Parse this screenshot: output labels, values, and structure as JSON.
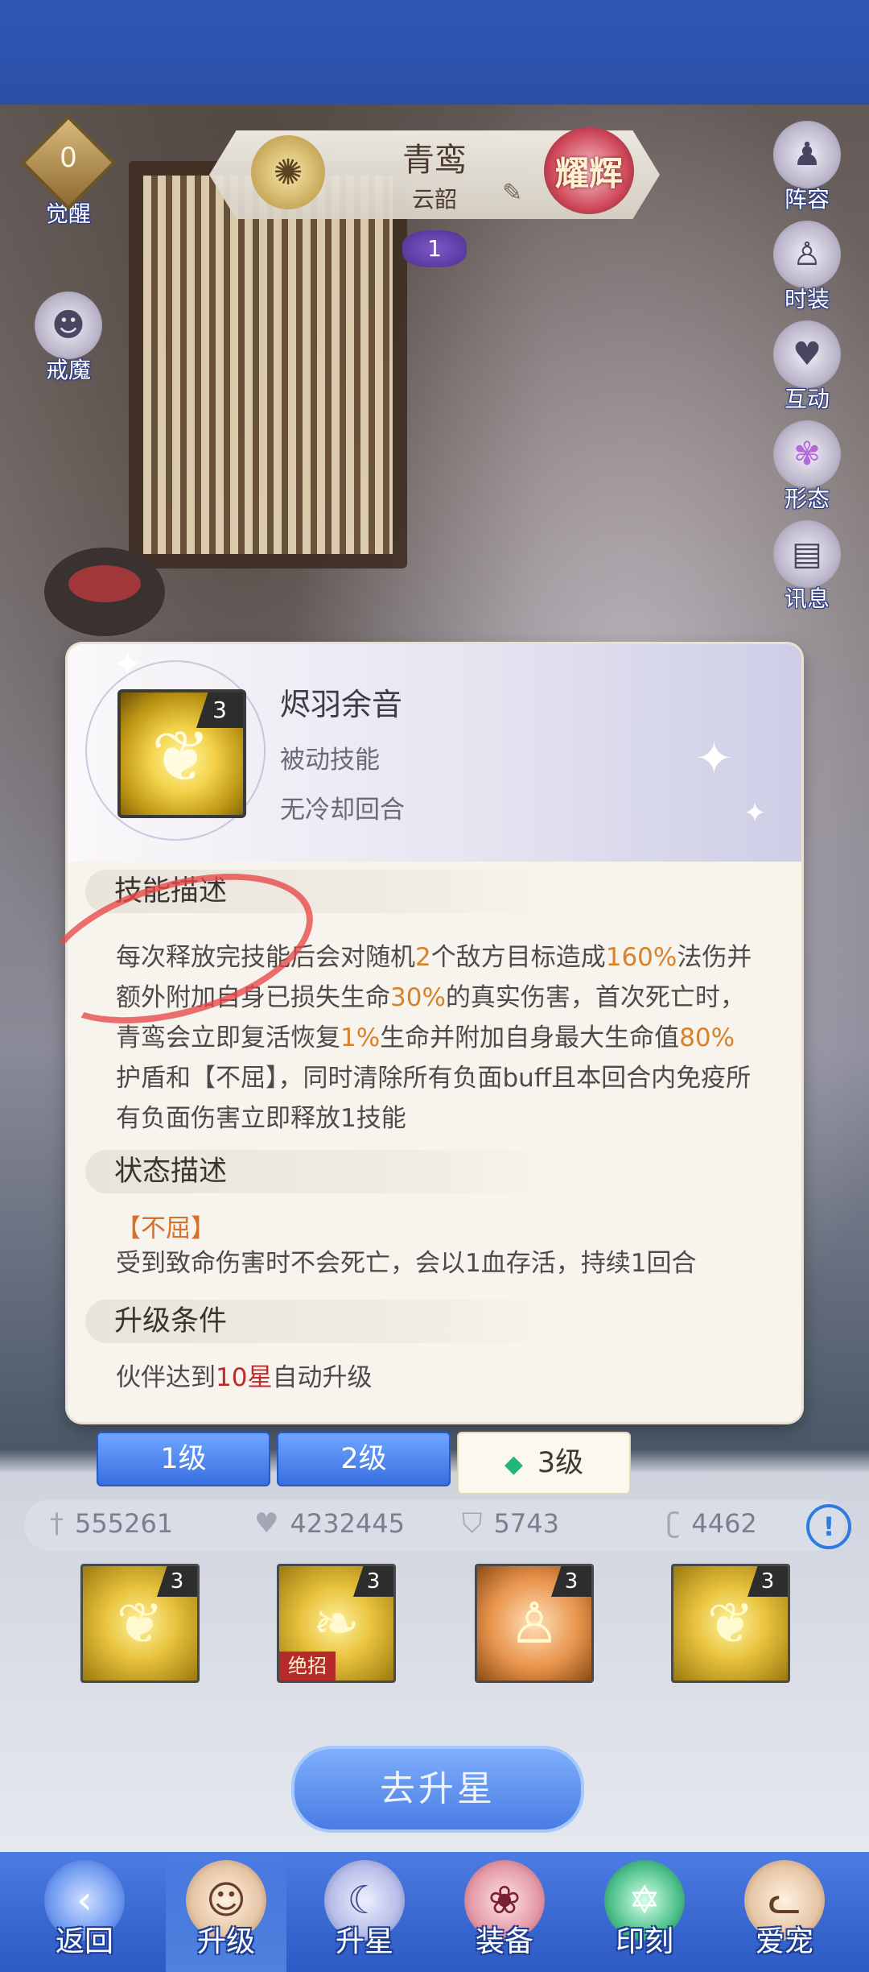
{
  "header": {
    "hero_name": "青鸾",
    "hero_subtitle": "云韶",
    "rank_label": "耀辉",
    "star_level": "1",
    "element_icon": "gear-sun-icon"
  },
  "left_buttons": {
    "awaken_count": "0",
    "awaken_label": "觉醒",
    "exorcise_label": "戒魔"
  },
  "right_buttons": [
    "阵容",
    "时装",
    "互动",
    "形态",
    "讯息"
  ],
  "popup": {
    "skill_name": "烬羽余音",
    "skill_level": "3",
    "skill_type": "被动技能",
    "cooldown": "无冷却回合",
    "desc_title": "技能描述",
    "desc_segments": [
      {
        "text": "每次释放完技能后会对随机",
        "hl": false
      },
      {
        "text": "2",
        "hl": true
      },
      {
        "text": "个敌方目标造成",
        "hl": false
      },
      {
        "text": "160%",
        "hl": true
      },
      {
        "text": "法伤并额外附加自身已损失生命",
        "hl": false
      },
      {
        "text": "30%",
        "hl": true
      },
      {
        "text": "的真实伤害，首次死亡时，青鸾会立即复活恢复",
        "hl": false
      },
      {
        "text": "1%",
        "hl": true
      },
      {
        "text": "生命并附加自身最大生命值",
        "hl": false
      },
      {
        "text": "80%",
        "hl": true
      },
      {
        "text": "护盾和【不屈】，同时清除所有负面buff且本回合内免疫所有负面伤害立即释放1技能",
        "hl": false
      }
    ],
    "status_title": "状态描述",
    "status_name": "【不屈】",
    "status_desc": "受到致命伤害时不会死亡，会以1血存活，持续1回合",
    "upgrade_title": "升级条件",
    "upgrade_pre": "伙伴达到",
    "upgrade_hl": "10星",
    "upgrade_post": "自动升级"
  },
  "level_tabs": [
    "1级",
    "2级",
    "3级"
  ],
  "active_level_tab": "3级",
  "stats": {
    "attack": "555261",
    "hp": "4232445",
    "defense": "5743",
    "speed": "4462"
  },
  "skills": [
    {
      "level": "3",
      "tag": ""
    },
    {
      "level": "3",
      "tag": "绝招"
    },
    {
      "level": "3",
      "tag": ""
    },
    {
      "level": "3",
      "tag": ""
    }
  ],
  "upstar_button": "去升星",
  "nav": {
    "back": "返回",
    "items": [
      "升级",
      "升星",
      "装备",
      "印刻",
      "爱宠"
    ],
    "active": "升级"
  },
  "colors": {
    "highlight_orange": "#d7822a",
    "highlight_red": "#c02a2a",
    "nav_blue": "#2d5ac4",
    "annotation_red": "#e84848"
  }
}
